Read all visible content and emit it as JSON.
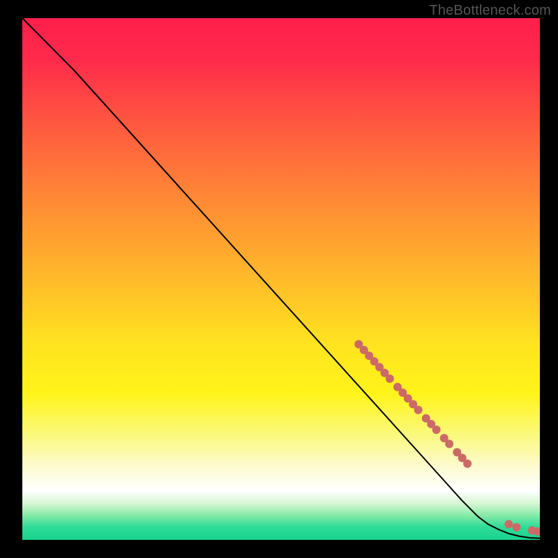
{
  "watermark": "TheBottleneck.com",
  "chart_data": {
    "type": "line",
    "title": "",
    "xlabel": "",
    "ylabel": "",
    "xlim": [
      0,
      100
    ],
    "ylim": [
      0,
      100
    ],
    "background_gradient": {
      "stops": [
        {
          "offset": 0.0,
          "color": "#ff1f4b"
        },
        {
          "offset": 0.08,
          "color": "#ff2b4b"
        },
        {
          "offset": 0.2,
          "color": "#ff5740"
        },
        {
          "offset": 0.35,
          "color": "#ff8a35"
        },
        {
          "offset": 0.5,
          "color": "#ffba2a"
        },
        {
          "offset": 0.62,
          "color": "#ffe220"
        },
        {
          "offset": 0.72,
          "color": "#fff41a"
        },
        {
          "offset": 0.8,
          "color": "#fbf97e"
        },
        {
          "offset": 0.86,
          "color": "#fdfbd0"
        },
        {
          "offset": 0.905,
          "color": "#ffffff"
        },
        {
          "offset": 0.93,
          "color": "#d7f7d3"
        },
        {
          "offset": 0.955,
          "color": "#7fe9a4"
        },
        {
          "offset": 0.975,
          "color": "#2fdc98"
        },
        {
          "offset": 1.0,
          "color": "#18d28d"
        }
      ]
    },
    "series": [
      {
        "name": "black-curve",
        "color": "#000000",
        "stroke_width": 2,
        "x": [
          0,
          3,
          6,
          10,
          15,
          20,
          25,
          30,
          35,
          40,
          45,
          50,
          55,
          60,
          65,
          70,
          75,
          80,
          85,
          88,
          90,
          92,
          94,
          96,
          98,
          100
        ],
        "y": [
          100,
          97,
          94,
          90,
          84.5,
          79,
          73.5,
          68,
          62.5,
          57,
          51.5,
          46,
          40.5,
          35,
          29.5,
          24,
          18.5,
          13,
          7.5,
          4.5,
          3,
          2,
          1.2,
          0.7,
          0.4,
          0.3
        ]
      }
    ],
    "markers": {
      "name": "highlight-points",
      "color": "#cc6a66",
      "radius": 6,
      "points": [
        {
          "x": 65.0,
          "y": 37.5
        },
        {
          "x": 66.0,
          "y": 36.4
        },
        {
          "x": 67.0,
          "y": 35.3
        },
        {
          "x": 68.0,
          "y": 34.2
        },
        {
          "x": 69.0,
          "y": 33.1
        },
        {
          "x": 70.0,
          "y": 32.0
        },
        {
          "x": 71.0,
          "y": 30.9
        },
        {
          "x": 72.5,
          "y": 29.3
        },
        {
          "x": 73.5,
          "y": 28.2
        },
        {
          "x": 74.5,
          "y": 27.1
        },
        {
          "x": 75.5,
          "y": 26.0
        },
        {
          "x": 76.5,
          "y": 24.9
        },
        {
          "x": 78.0,
          "y": 23.3
        },
        {
          "x": 79.0,
          "y": 22.2
        },
        {
          "x": 80.0,
          "y": 21.1
        },
        {
          "x": 81.5,
          "y": 19.5
        },
        {
          "x": 82.5,
          "y": 18.4
        },
        {
          "x": 84.0,
          "y": 16.8
        },
        {
          "x": 85.0,
          "y": 15.7
        },
        {
          "x": 86.0,
          "y": 14.6
        },
        {
          "x": 94.0,
          "y": 3.0
        },
        {
          "x": 95.5,
          "y": 2.4
        },
        {
          "x": 98.5,
          "y": 1.8
        },
        {
          "x": 99.5,
          "y": 1.6
        }
      ]
    }
  }
}
